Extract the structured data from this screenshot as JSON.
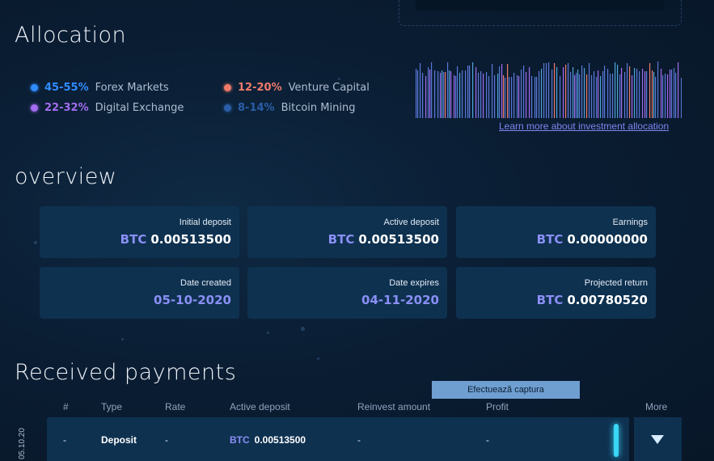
{
  "allocation": {
    "title": "Allocation",
    "items": [
      {
        "pct": "45-55%",
        "label": "Forex Markets",
        "color": "#2f8cff"
      },
      {
        "pct": "22-32%",
        "label": "Digital Exchange",
        "color": "#a46cf0"
      },
      {
        "pct": "12-20%",
        "label": "Venture Capital",
        "color": "#f07b6a"
      },
      {
        "pct": "8-14%",
        "label": "Bitcoin Mining",
        "color": "#2a5ea8"
      }
    ],
    "link": "Learn more about investment allocation"
  },
  "overview": {
    "title": "overview",
    "cards": [
      {
        "label": "Initial deposit",
        "currency": "BTC",
        "value": "0.00513500"
      },
      {
        "label": "Active deposit",
        "currency": "BTC",
        "value": "0.00513500"
      },
      {
        "label": "Earnings",
        "currency": "BTC",
        "value": "0.00000000"
      },
      {
        "label": "Date created",
        "currency": "",
        "value": "05-10-2020"
      },
      {
        "label": "Date expires",
        "currency": "",
        "value": "04-11-2020"
      },
      {
        "label": "Projected return",
        "currency": "BTC",
        "value": "0.00780520"
      }
    ]
  },
  "payments": {
    "title": "Received payments",
    "capture_button": "Efectuează captura",
    "headers": [
      "#",
      "Type",
      "Rate",
      "Active deposit",
      "Reinvest amount",
      "Profit",
      "More"
    ],
    "rows": [
      {
        "date": "05.10.20",
        "num": "-",
        "type": "Deposit",
        "rate": "-",
        "currency": "BTC",
        "deposit": "0.00513500",
        "reinvest": "-",
        "profit": "-"
      }
    ]
  },
  "icons": {
    "expand": "chevron-down-icon"
  }
}
